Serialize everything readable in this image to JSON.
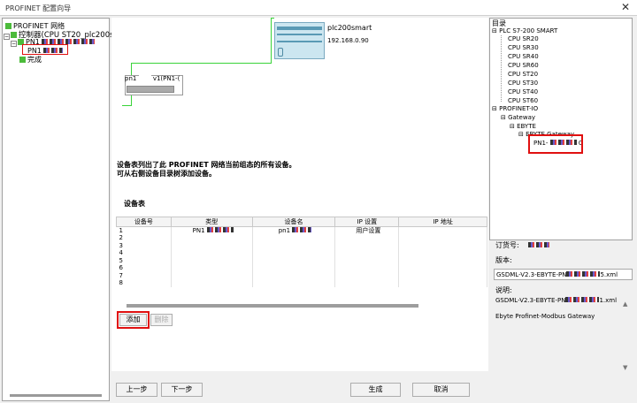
{
  "window": {
    "title": "PROFINET 配置向导",
    "close_glyph": "✕"
  },
  "left_tree": {
    "root": "PROFINET 网络",
    "controller": "控制器(CPU ST20_plc200smart)",
    "device_prefix": "PN1",
    "device_child": "PN1",
    "finish": "完成"
  },
  "topology": {
    "plc_name": "plc200smart",
    "plc_ip": "192.168.0.90",
    "device_label_a": "pn1",
    "device_label_b": "v1(PN1-("
  },
  "info_text": [
    "设备表列出了此 PROFINET 网络当前组态的所有设备。",
    "可从右侧设备目录树添加设备。"
  ],
  "device_table": {
    "title": "设备表",
    "headers": [
      "设备号",
      "类型",
      "设备名",
      "IP 设置",
      "IP 地址"
    ],
    "rows": [
      [
        "1",
        "PN1",
        "pn1",
        "用户设置",
        ""
      ],
      [
        "2",
        "",
        "",
        "",
        ""
      ],
      [
        "3",
        "",
        "",
        "",
        ""
      ],
      [
        "4",
        "",
        "",
        "",
        ""
      ],
      [
        "5",
        "",
        "",
        "",
        ""
      ],
      [
        "6",
        "",
        "",
        "",
        ""
      ],
      [
        "7",
        "",
        "",
        "",
        ""
      ],
      [
        "8",
        "",
        "",
        "",
        ""
      ]
    ]
  },
  "table_buttons": {
    "add": "添加",
    "delete": "删除"
  },
  "catalog": {
    "title": "目录",
    "plc_group": "PLC S7-200 SMART",
    "cpus": [
      "CPU SR20",
      "CPU SR30",
      "CPU SR40",
      "CPU SR60",
      "CPU ST20",
      "CPU ST30",
      "CPU ST40",
      "CPU ST60"
    ],
    "profinet_io": "PROFINET-IO",
    "gateway": "Gateway",
    "ebyte": "EBYTE",
    "ebyte_gateway": "EBYTE Gateway",
    "selected_device": "PN1-"
  },
  "details": {
    "order_label": "订货号:",
    "version_label": "版本:",
    "version_value": "GSDML-V2.3-EBYTE-PN",
    "version_suffix": "5.xml",
    "desc_label": "说明:",
    "desc_value": "GSDML-V2.3-EBYTE-PN",
    "desc_suffix": "1.xml",
    "desc_text": "Ebyte Profinet-Modbus Gateway"
  },
  "footer": {
    "prev": "上一步",
    "next": "下一步",
    "generate": "生成",
    "cancel": "取消"
  },
  "colors": {
    "accent_red": "#e01010",
    "network_green": "#39d339",
    "tree_green": "#4cbb3b"
  }
}
